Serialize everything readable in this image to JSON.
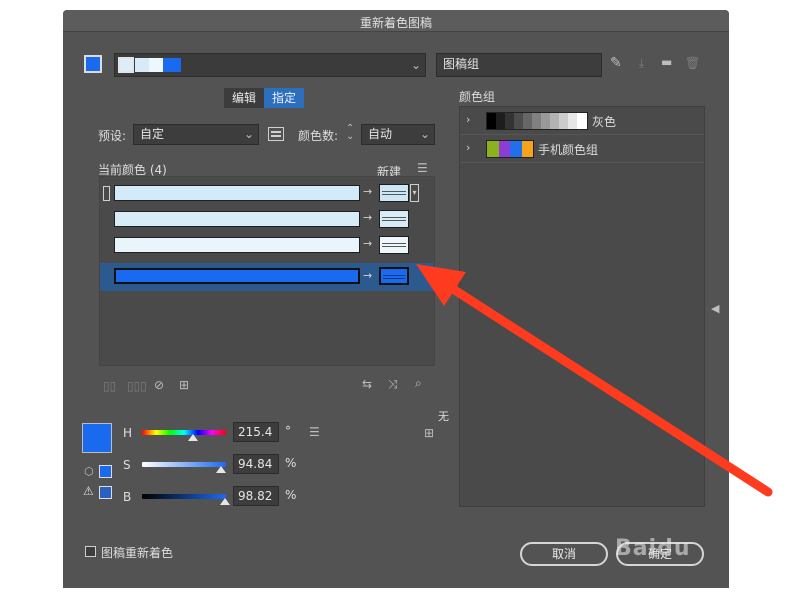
{
  "dialog": {
    "title": "重新着色图稿",
    "artwork_group_name": "图稿组",
    "colors": {
      "accent": "#1a6af0",
      "selection": "#2d6fbd",
      "panel": "#535353",
      "annotation": "#ff3b1f"
    }
  },
  "tabs": [
    {
      "label": "编辑"
    },
    {
      "label": "指定"
    }
  ],
  "preset": {
    "label": "预设:",
    "value": "自定"
  },
  "color_count": {
    "label": "颜色数:",
    "value": "自动"
  },
  "current_colors": {
    "label": "当前颜色 (4)",
    "new_label": "新建"
  },
  "color_rows": [
    {
      "current": "#d3ebf8",
      "new": "#cde6f6"
    },
    {
      "current": "#d8ecf8",
      "new": "#d8ecf8"
    },
    {
      "current": "#eaf5fb",
      "new": "#ecf6fb"
    },
    {
      "current": "#1a6af0",
      "new": "#1a6af0"
    }
  ],
  "color_groups": {
    "label": "颜色组",
    "groups": [
      {
        "name": "灰色",
        "colors": [
          "#000000",
          "#1d1d1d",
          "#333333",
          "#4d4d4d",
          "#666666",
          "#808080",
          "#999999",
          "#b3b3b3",
          "#cccccc",
          "#e6e6e6",
          "#ffffff"
        ]
      },
      {
        "name": "手机颜色组",
        "colors": [
          "#8bb21b",
          "#8b3ed6",
          "#2170ea",
          "#f5a31b"
        ]
      }
    ]
  },
  "hsb": {
    "h": {
      "label": "H",
      "value": "215.4",
      "unit": "°"
    },
    "s": {
      "label": "S",
      "value": "94.84",
      "unit": "%"
    },
    "b": {
      "label": "B",
      "value": "98.82",
      "unit": "%"
    }
  },
  "none_label": "无",
  "recolor_checkbox": {
    "label": "图稿重新着色",
    "checked": false
  },
  "buttons": {
    "cancel": "取消",
    "ok": "确定"
  },
  "watermark": "Baidu",
  "icons": [
    "eyedropper-icon",
    "save-group-icon",
    "folder-icon",
    "trash-icon",
    "color-library-icon",
    "menu-icon",
    "expand-panel-icon"
  ]
}
